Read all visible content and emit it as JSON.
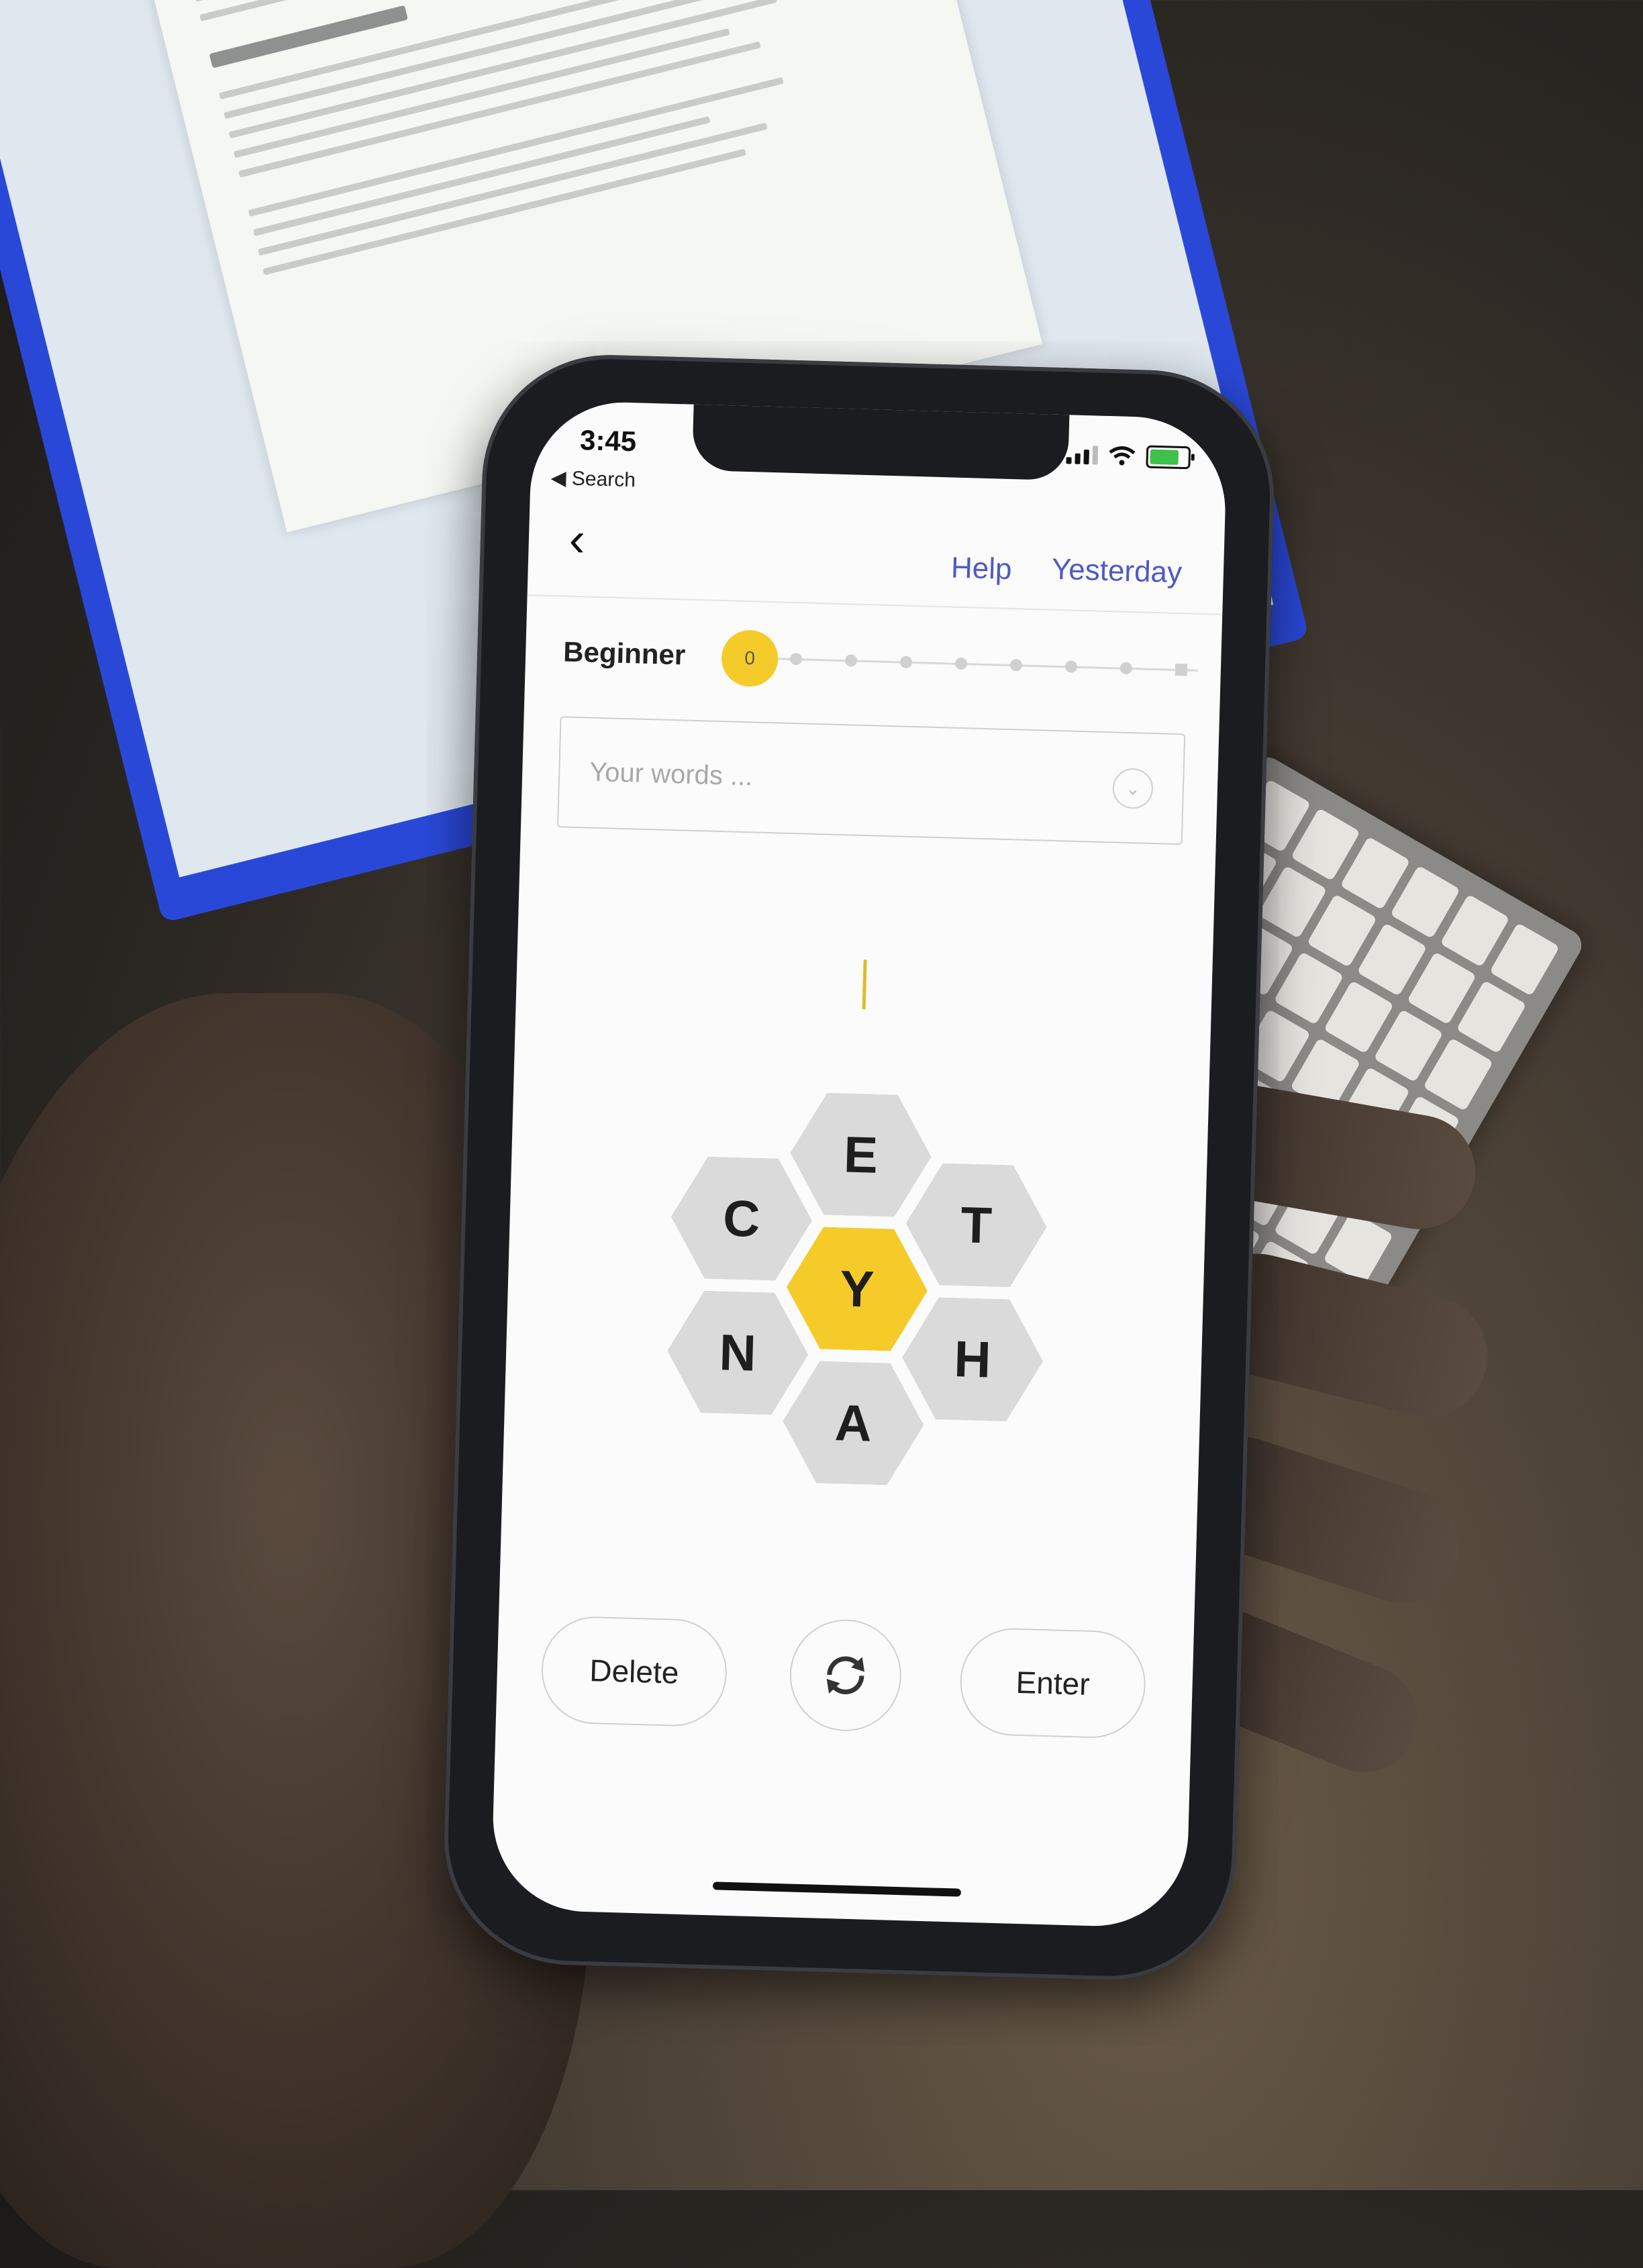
{
  "status_bar": {
    "time": "3:45",
    "back_app": "◀ Search"
  },
  "nav": {
    "back_icon": "‹",
    "help_label": "Help",
    "yesterday_label": "Yesterday"
  },
  "rank": {
    "label": "Beginner",
    "score": "0",
    "steps": 9
  },
  "words": {
    "placeholder": "Your words ...",
    "toggle_icon": "⌄"
  },
  "hive": {
    "center": "Y",
    "outer": [
      "E",
      "T",
      "H",
      "A",
      "N",
      "C"
    ]
  },
  "controls": {
    "delete_label": "Delete",
    "enter_label": "Enter",
    "shuffle_icon": "shuffle-icon"
  },
  "colors": {
    "accent": "#f5cb2a",
    "link": "#4f59c7",
    "cell": "#dadada"
  }
}
